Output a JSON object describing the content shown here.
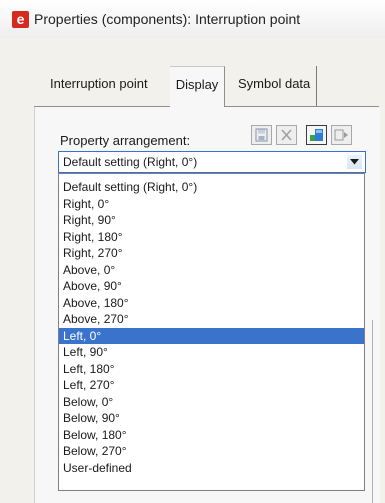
{
  "window": {
    "title": "Properties (components): Interruption point",
    "icon": "e"
  },
  "tabs": [
    {
      "label": "Interruption point"
    },
    {
      "label": "Display",
      "active": true
    },
    {
      "label": "Symbol data"
    }
  ],
  "property_arrangement": {
    "label": "Property arrangement:",
    "value": "Default setting (Right, 0°)",
    "toolbar_icons": [
      "save-icon",
      "delete-icon",
      "assign-icon",
      "extra-icon"
    ],
    "selected_index": 9,
    "options": [
      "Default setting (Right, 0°)",
      "Right, 0°",
      "Right, 90°",
      "Right, 180°",
      "Right, 270°",
      "Above, 0°",
      "Above, 90°",
      "Above, 180°",
      "Above, 270°",
      "Left, 0°",
      "Left, 90°",
      "Left, 180°",
      "Left, 270°",
      "Below, 0°",
      "Below, 90°",
      "Below, 180°",
      "Below, 270°",
      "User-defined"
    ]
  },
  "colors": {
    "selection": "#3a73cb",
    "app_icon": "#d42a1f",
    "focus_border": "#3c6fd0"
  }
}
